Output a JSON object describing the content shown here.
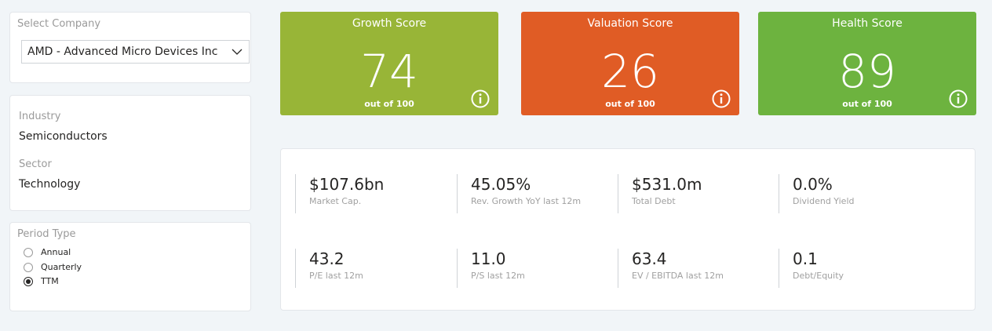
{
  "company": {
    "label": "Select Company",
    "selected": "AMD - Advanced Micro Devices Inc"
  },
  "info": {
    "industry_label": "Industry",
    "industry_value": "Semiconductors",
    "sector_label": "Sector",
    "sector_value": "Technology"
  },
  "period": {
    "label": "Period Type",
    "options": [
      {
        "label": "Annual",
        "checked": false
      },
      {
        "label": "Quarterly",
        "checked": false
      },
      {
        "label": "TTM",
        "checked": true
      }
    ]
  },
  "scores": [
    {
      "title": "Growth Score",
      "value": "74",
      "sub": "out of 100",
      "color": "#98b537"
    },
    {
      "title": "Valuation Score",
      "value": "26",
      "sub": "out of 100",
      "color": "#e05c25"
    },
    {
      "title": "Health Score",
      "value": "89",
      "sub": "out of 100",
      "color": "#6db33f"
    }
  ],
  "metrics": [
    {
      "value": "$107.6bn",
      "label": "Market Cap."
    },
    {
      "value": "45.05%",
      "label": "Rev. Growth YoY last 12m"
    },
    {
      "value": "$531.0m",
      "label": "Total Debt"
    },
    {
      "value": "0.0%",
      "label": "Dividend Yield"
    },
    {
      "value": "43.2",
      "label": "P/E last 12m"
    },
    {
      "value": "11.0",
      "label": "P/S last 12m"
    },
    {
      "value": "63.4",
      "label": "EV / EBITDA last 12m"
    },
    {
      "value": "0.1",
      "label": "Debt/Equity"
    }
  ]
}
